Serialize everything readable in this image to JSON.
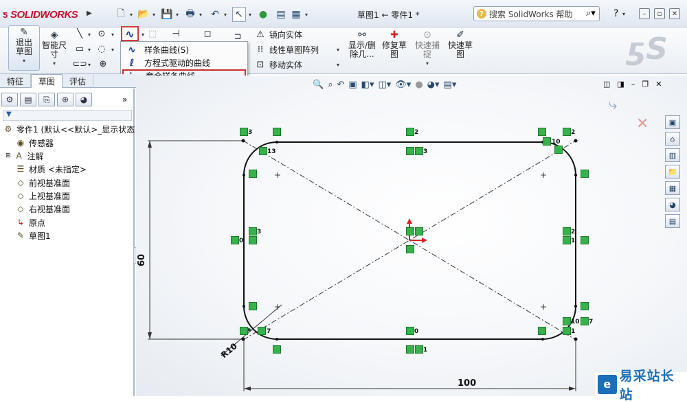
{
  "titlebar": {
    "logo_text": "SOLIDWORKS",
    "doc_title": "草图1 ← 零件1 *",
    "help_placeholder": "搜索 SolidWorks 帮助"
  },
  "ribbon": {
    "exit_sketch": "退出草图",
    "smart_dimension": "智能尺寸",
    "mirror": "镜向实体",
    "linear_pattern": "线性草图阵列",
    "move": "移动实体",
    "show_delete": "显示/删除几...",
    "repair": "修复草图",
    "quick_snap": "快速捕捉",
    "rapid_sketch": "快速草图"
  },
  "spline_menu": {
    "items": [
      {
        "label": "样条曲线(S)"
      },
      {
        "label": "方程式驱动的曲线"
      },
      {
        "label": "套合样条曲线"
      }
    ]
  },
  "tabs": [
    {
      "label": "特征"
    },
    {
      "label": "草图"
    },
    {
      "label": "评估"
    }
  ],
  "tree": {
    "root": "零件1 (默认<<默认>_显示状态",
    "items": [
      {
        "label": "传感器"
      },
      {
        "label": "注解"
      },
      {
        "label": "材质 <未指定>"
      },
      {
        "label": "前视基准面"
      },
      {
        "label": "上视基准面"
      },
      {
        "label": "右视基准面"
      },
      {
        "label": "原点"
      },
      {
        "label": "草图1"
      }
    ]
  },
  "sketch": {
    "dim_height": "60",
    "dim_width": "100",
    "dim_radius": "R10"
  },
  "watermark": {
    "text": "易采站长站"
  }
}
